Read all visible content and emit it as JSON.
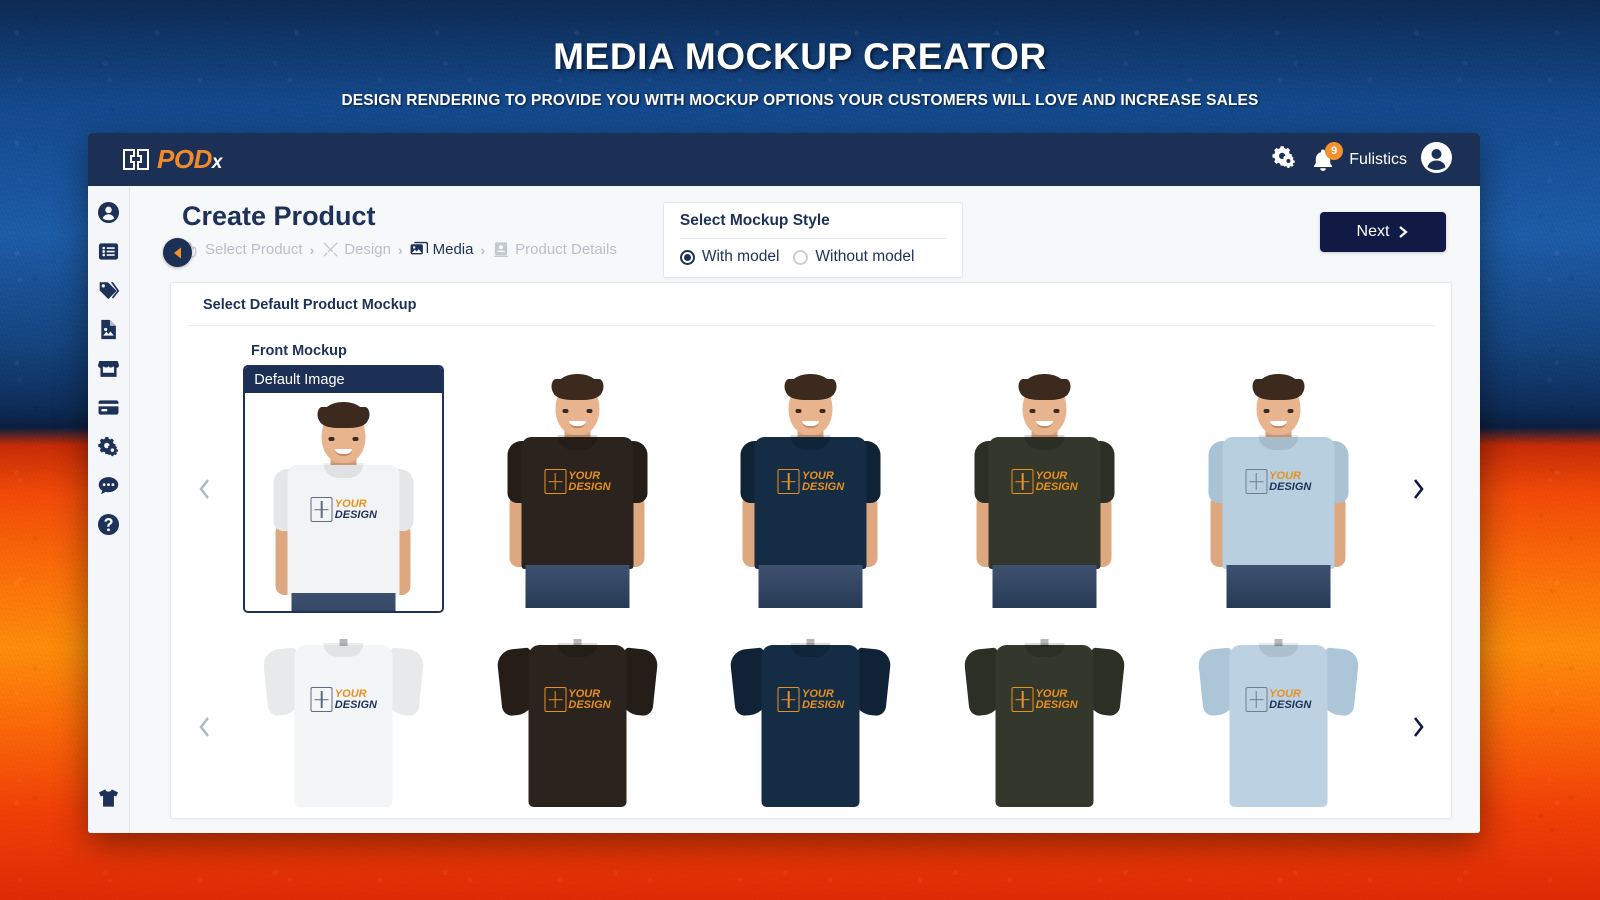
{
  "banner": {
    "title": "MEDIA MOCKUP CREATOR",
    "subtitle": "DESIGN RENDERING TO PROVIDE YOU WITH MOCKUP OPTIONS YOUR CUSTOMERS WILL LOVE AND INCREASE SALES"
  },
  "topbar": {
    "logo_pod": "POD",
    "logo_x": "x",
    "notification_count": "9",
    "user_name": "Fulistics",
    "icons": [
      "gears-icon",
      "bell-icon",
      "avatar-icon"
    ]
  },
  "sidebar": {
    "items": [
      {
        "icon": "user-circle-icon",
        "name": "account"
      },
      {
        "icon": "list-icon",
        "name": "orders"
      },
      {
        "icon": "tag-icon",
        "name": "products"
      },
      {
        "icon": "image-file-icon",
        "name": "media"
      },
      {
        "icon": "store-icon",
        "name": "store"
      },
      {
        "icon": "credit-card-icon",
        "name": "billing"
      },
      {
        "icon": "gears-icon",
        "name": "settings"
      },
      {
        "icon": "chat-icon",
        "name": "messages"
      },
      {
        "icon": "help-icon",
        "name": "help"
      }
    ],
    "bottom_item": {
      "icon": "tshirt-icon",
      "name": "catalog"
    },
    "collapse_icon": "collapse-left-icon"
  },
  "page": {
    "title": "Create Product",
    "breadcrumb": [
      {
        "label": "Select Product",
        "icon": "hand-pointer-icon",
        "active": false
      },
      {
        "label": "Design",
        "icon": "pencil-ruler-icon",
        "active": false
      },
      {
        "label": "Media",
        "icon": "photos-icon",
        "active": true
      },
      {
        "label": "Product Details",
        "icon": "document-icon",
        "active": false
      }
    ],
    "separator": "›"
  },
  "mockup_style": {
    "title": "Select Mockup Style",
    "options": [
      {
        "label": "With model",
        "selected": true
      },
      {
        "label": "Without model",
        "selected": false
      }
    ]
  },
  "next_button": {
    "label": "Next",
    "icon": "chevron-right-icon"
  },
  "content": {
    "title": "Select Default Product Mockup",
    "section_label": "Front Mockup",
    "default_badge": "Default Image"
  },
  "carousel": {
    "prev_icon": "chevron-left-icon",
    "next_icon": "chevron-right-icon",
    "row1_prev_enabled": false,
    "row1_next_enabled": true,
    "row2_prev_enabled": false,
    "row2_next_enabled": true
  },
  "design_print": {
    "line1": "YOUR",
    "line2": "DESIGN",
    "line1_color": "#e8901f",
    "line2_color": "#1d3159"
  },
  "mockups_with_model": [
    {
      "name": "white",
      "shirt": "#f2f3f4",
      "sleeve": "#e4e6e8",
      "design_tone": "dark",
      "selected": true,
      "label": "Default Image"
    },
    {
      "name": "black",
      "shirt": "#2b231d",
      "sleeve": "#241d18",
      "design_tone": "light",
      "selected": false,
      "label": ""
    },
    {
      "name": "navy",
      "shirt": "#142c44",
      "sleeve": "#102336",
      "design_tone": "light",
      "selected": false,
      "label": ""
    },
    {
      "name": "dark-olive",
      "shirt": "#33372c",
      "sleeve": "#2b2f25",
      "design_tone": "light",
      "selected": false,
      "label": ""
    },
    {
      "name": "light-blue",
      "shirt": "#b8cfdf",
      "sleeve": "#a9c3d4",
      "design_tone": "dark",
      "selected": false,
      "label": ""
    }
  ],
  "mockups_flat": [
    {
      "name": "white",
      "shirt": "#f4f5f6",
      "sleeve": "#e7e9ea",
      "design_tone": "dark",
      "selected": false
    },
    {
      "name": "black",
      "shirt": "#2b231d",
      "sleeve": "#241d18",
      "design_tone": "light",
      "selected": false
    },
    {
      "name": "navy",
      "shirt": "#142c44",
      "sleeve": "#102336",
      "design_tone": "light",
      "selected": false
    },
    {
      "name": "dark-olive",
      "shirt": "#33372c",
      "sleeve": "#2b2f25",
      "design_tone": "light",
      "selected": false
    },
    {
      "name": "light-blue",
      "shirt": "#bcd2e2",
      "sleeve": "#adc6d7",
      "design_tone": "dark",
      "selected": false
    }
  ],
  "colors": {
    "brand_navy": "#1b3054",
    "brand_orange": "#f08a2a",
    "accent_dark": "#101a45",
    "badge_orange": "#f39030"
  }
}
